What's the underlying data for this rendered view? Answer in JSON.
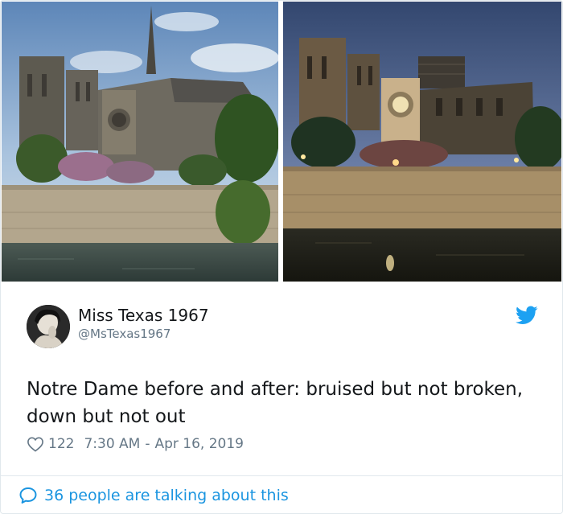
{
  "tweet": {
    "display_name": "Miss Texas 1967",
    "handle": "@MsTexas1967",
    "text": "Notre Dame before and after: bruised but not broken, down but not out",
    "like_count": "122",
    "time": "7:30 AM",
    "separator": "-",
    "date": "Apr 16, 2019",
    "conversation": "36 people are talking about this"
  },
  "icons": {
    "brand": "twitter-bird-icon",
    "like": "heart-icon",
    "reply": "speech-bubble-icon"
  },
  "colors": {
    "accent": "#1b95e0",
    "text_primary": "#14171a",
    "text_secondary": "#657786",
    "border": "#e1e8ed"
  }
}
